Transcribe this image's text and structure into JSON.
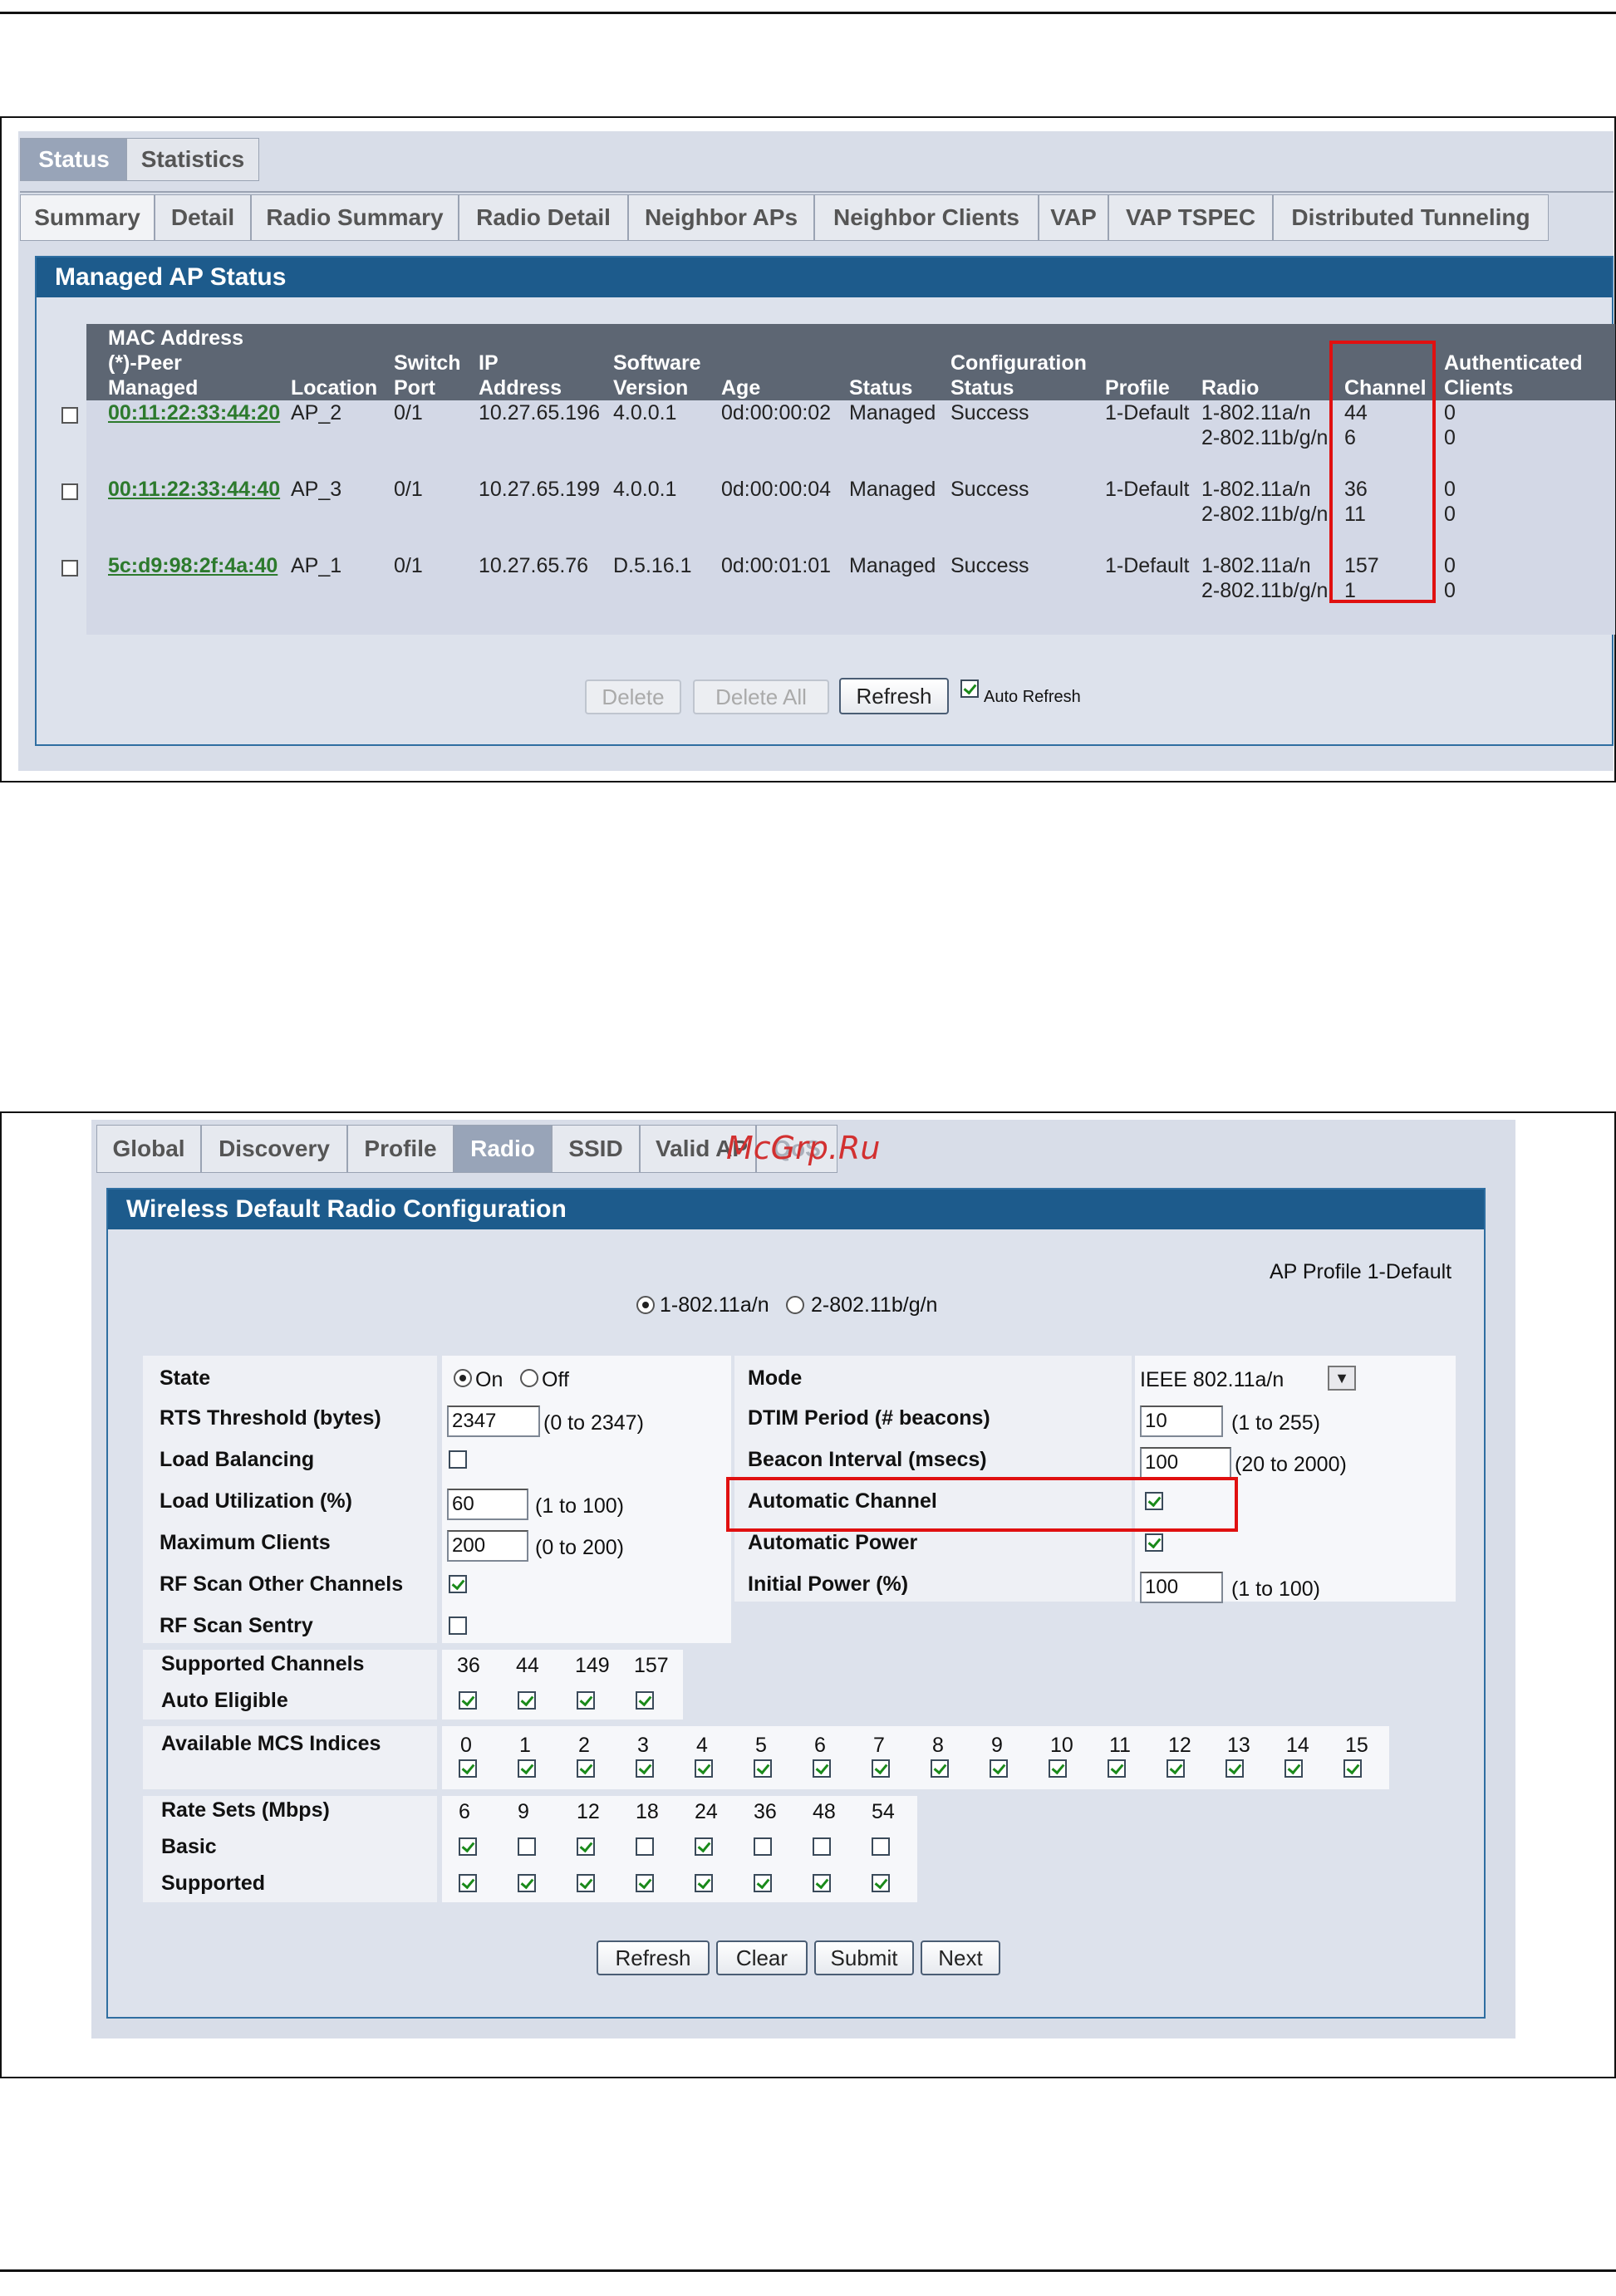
{
  "screen1": {
    "top_tabs": [
      "Status",
      "Statistics"
    ],
    "sub_tabs": [
      "Summary",
      "Detail",
      "Radio Summary",
      "Radio Detail",
      "Neighbor APs",
      "Neighbor Clients",
      "VAP",
      "VAP TSPEC",
      "Distributed Tunneling"
    ],
    "section_title": "Managed AP Status",
    "headers": {
      "mac": [
        "MAC Address",
        "(*)-Peer",
        "Managed"
      ],
      "location": "Location",
      "switch_port": [
        "Switch",
        "Port"
      ],
      "ip": [
        "IP",
        "Address"
      ],
      "software": [
        "Software",
        "Version"
      ],
      "age": "Age",
      "status": "Status",
      "config": [
        "Configuration",
        "Status"
      ],
      "profile": "Profile",
      "radio": "Radio",
      "channel": "Channel",
      "clients": [
        "Authenticated",
        "Clients"
      ]
    },
    "rows": [
      {
        "mac": "00:11:22:33:44:20",
        "location": "AP_2",
        "port": "0/1",
        "ip": "10.27.65.196",
        "version": "4.0.0.1",
        "age": "0d:00:00:02",
        "status": "Managed",
        "config": "Success",
        "profile": "1-Default",
        "radio1": "1-802.11a/n",
        "radio2": "2-802.11b/g/n",
        "ch1": "44",
        "ch2": "6",
        "cl1": "0",
        "cl2": "0"
      },
      {
        "mac": "00:11:22:33:44:40",
        "location": "AP_3",
        "port": "0/1",
        "ip": "10.27.65.199",
        "version": "4.0.0.1",
        "age": "0d:00:00:04",
        "status": "Managed",
        "config": "Success",
        "profile": "1-Default",
        "radio1": "1-802.11a/n",
        "radio2": "2-802.11b/g/n",
        "ch1": "36",
        "ch2": "11",
        "cl1": "0",
        "cl2": "0"
      },
      {
        "mac": "5c:d9:98:2f:4a:40",
        "location": "AP_1",
        "port": "0/1",
        "ip": "10.27.65.76",
        "version": "D.5.16.1",
        "age": "0d:00:01:01",
        "status": "Managed",
        "config": "Success",
        "profile": "1-Default",
        "radio1": "1-802.11a/n",
        "radio2": "2-802.11b/g/n",
        "ch1": "157",
        "ch2": "1",
        "cl1": "0",
        "cl2": "0"
      }
    ],
    "buttons": {
      "delete": "Delete",
      "delete_all": "Delete All",
      "refresh": "Refresh"
    },
    "auto_refresh": "Auto Refresh"
  },
  "screen2": {
    "tabs": [
      "Global",
      "Discovery",
      "Profile",
      "Radio",
      "SSID",
      "Valid AP",
      "QoS"
    ],
    "watermark": "McGrp.Ru",
    "section_title": "Wireless Default Radio Configuration",
    "ap_profile": "AP Profile 1-Default",
    "radio_opts": [
      "1-802.11a/n",
      "2-802.11b/g/n"
    ],
    "left": {
      "state": "State",
      "on": "On",
      "off": "Off",
      "rts": "RTS Threshold (bytes)",
      "rts_val": "2347",
      "rts_range": "(0 to 2347)",
      "load_bal": "Load Balancing",
      "load_util": "Load Utilization (%)",
      "load_util_val": "60",
      "load_util_range": "(1 to 100)",
      "max_clients": "Maximum Clients",
      "max_clients_val": "200",
      "max_clients_range": "(0 to 200)",
      "rf_scan": "RF Scan Other Channels",
      "rf_sentry": "RF Scan Sentry"
    },
    "right": {
      "mode": "Mode",
      "mode_val": "IEEE 802.11a/n",
      "dtim": "DTIM Period (# beacons)",
      "dtim_val": "10",
      "dtim_range": "(1 to 255)",
      "beacon": "Beacon Interval (msecs)",
      "beacon_val": "100",
      "beacon_range": "(20 to 2000)",
      "auto_channel": "Automatic Channel",
      "auto_power": "Automatic Power",
      "init_power": "Initial Power (%)",
      "init_power_val": "100",
      "init_power_range": "(1 to 100)"
    },
    "supported_channels": {
      "label": "Supported Channels",
      "auto_label": "Auto Eligible",
      "values": [
        "36",
        "44",
        "149",
        "157"
      ]
    },
    "mcs": {
      "label": "Available MCS Indices",
      "values": [
        "0",
        "1",
        "2",
        "3",
        "4",
        "5",
        "6",
        "7",
        "8",
        "9",
        "10",
        "11",
        "12",
        "13",
        "14",
        "15"
      ]
    },
    "rates": {
      "label": "Rate Sets (Mbps)",
      "basic_label": "Basic",
      "supported_label": "Supported",
      "values": [
        "6",
        "9",
        "12",
        "18",
        "24",
        "36",
        "48",
        "54"
      ],
      "basic": [
        true,
        false,
        true,
        false,
        true,
        false,
        false,
        false
      ],
      "supported": [
        true,
        true,
        true,
        true,
        true,
        true,
        true,
        true
      ]
    },
    "buttons": {
      "refresh": "Refresh",
      "clear": "Clear",
      "submit": "Submit",
      "next": "Next"
    }
  }
}
